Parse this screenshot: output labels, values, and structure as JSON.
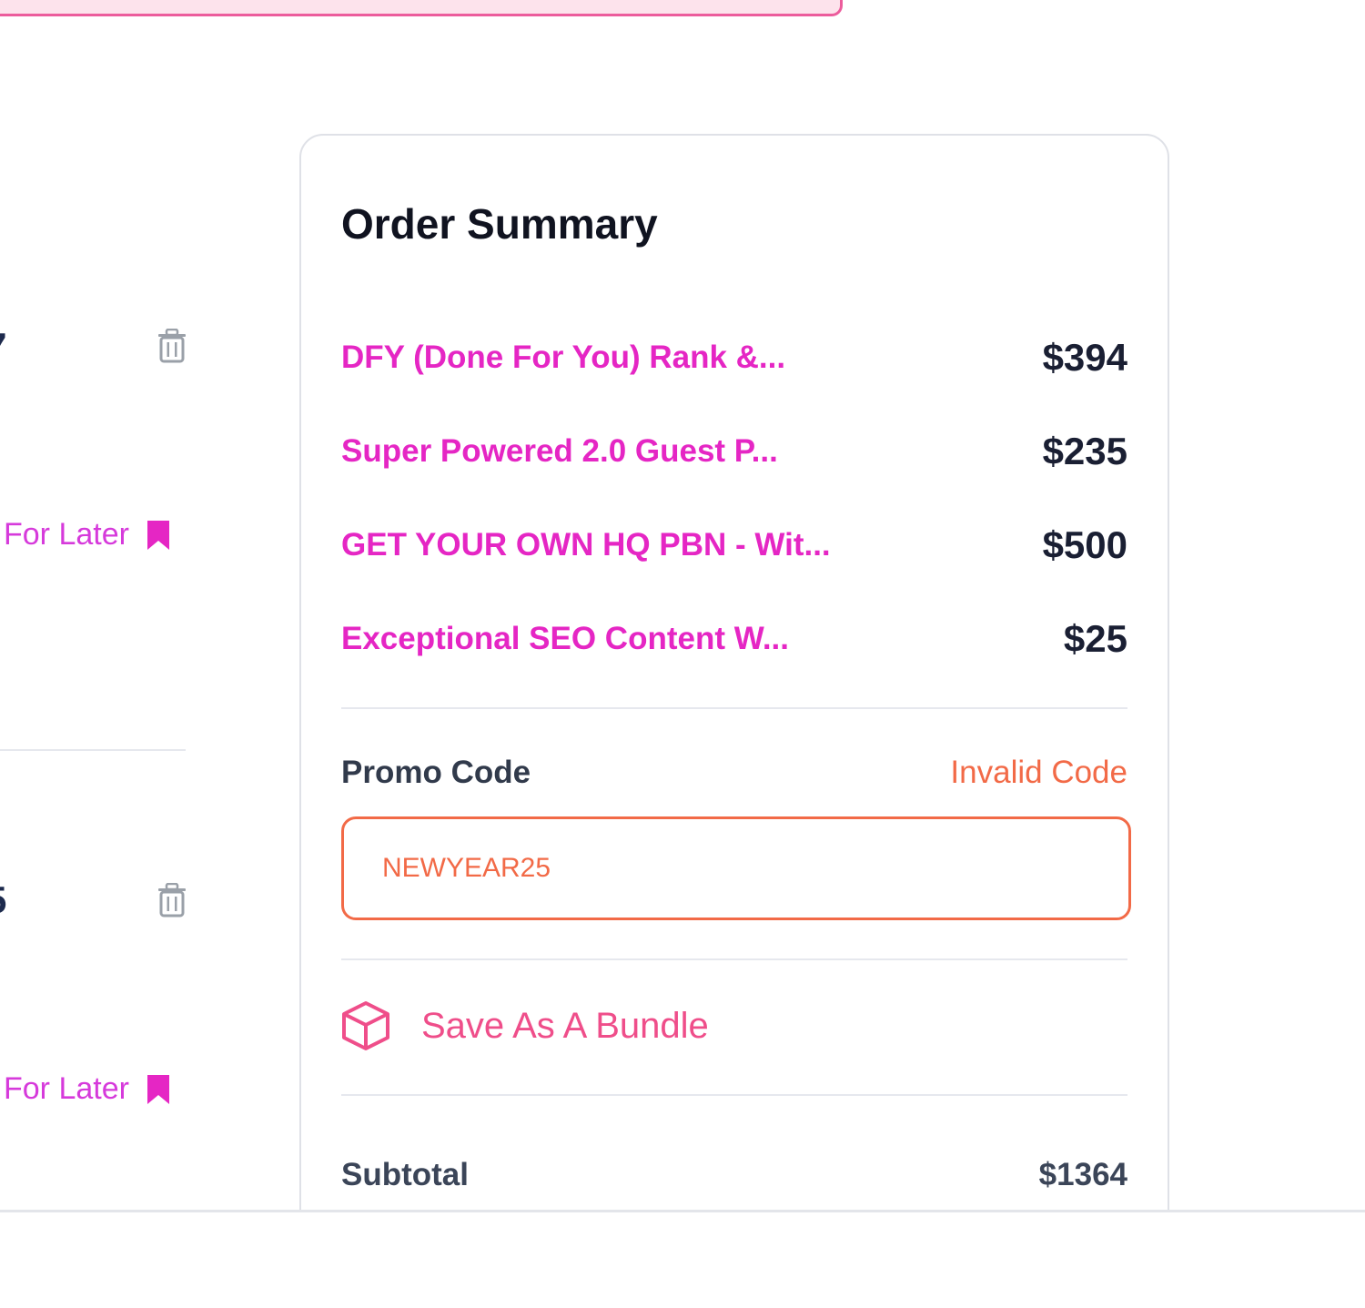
{
  "left_cart": {
    "items": [
      {
        "price_fragment": "7",
        "save_label": "For Later"
      },
      {
        "price_fragment": "5",
        "save_label": "For Later"
      }
    ]
  },
  "order_summary": {
    "title": "Order Summary",
    "items": [
      {
        "name": "DFY (Done For You) Rank &...",
        "price": "$394"
      },
      {
        "name": "Super Powered 2.0 Guest P...",
        "price": "$235"
      },
      {
        "name": "GET YOUR OWN HQ PBN - Wit...",
        "price": "$500"
      },
      {
        "name": "Exceptional SEO Content W...",
        "price": "$25"
      }
    ],
    "promo": {
      "label": "Promo Code",
      "status": "Invalid Code",
      "value": "NEWYEAR25"
    },
    "bundle_label": "Save As A Bundle",
    "subtotal_label": "Subtotal",
    "subtotal_value": "$1364"
  },
  "colors": {
    "accent_magenta": "#e526c4",
    "error_orange": "#f26a47",
    "bundle_pink": "#ef4e8a",
    "banner_pink": "#fde3ec"
  },
  "icons": {
    "trash": "trash-icon",
    "bookmark": "bookmark-icon",
    "bundle": "box-icon"
  }
}
